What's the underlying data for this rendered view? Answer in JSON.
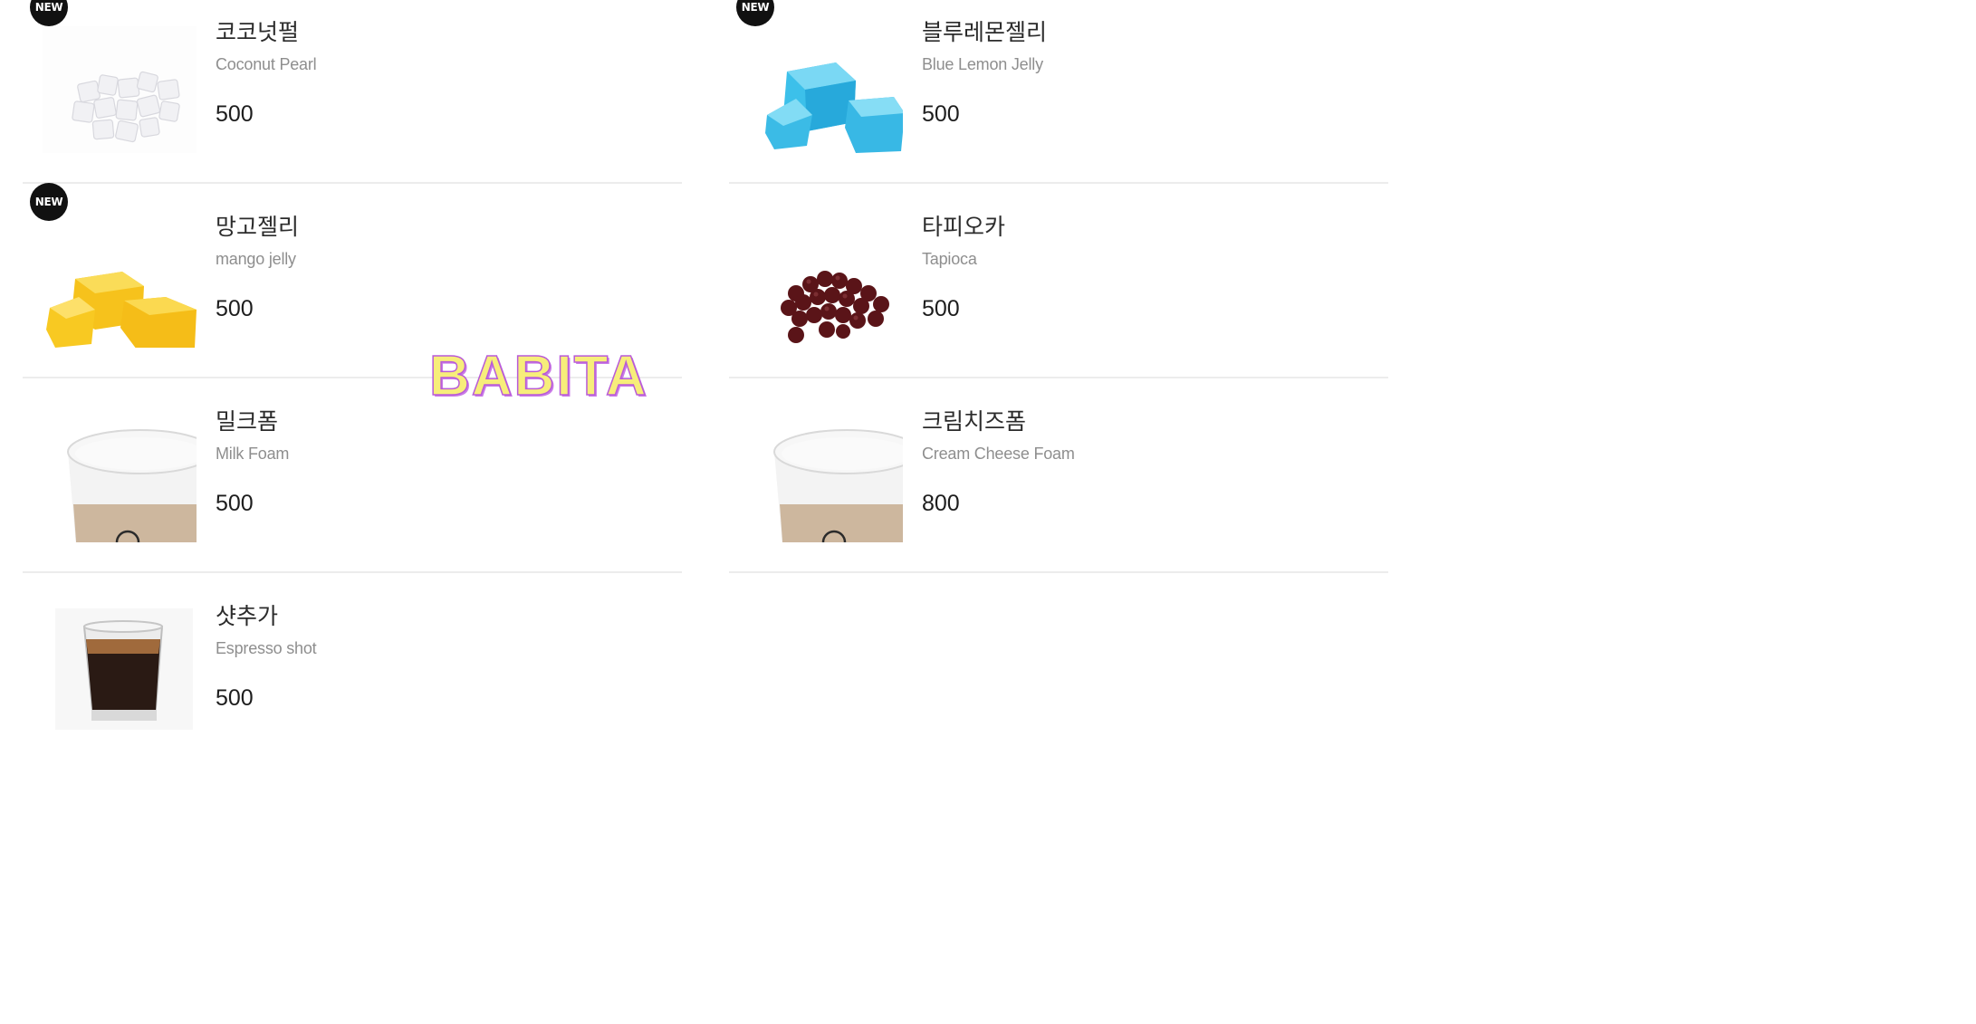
{
  "items": [
    {
      "name_ko": "코코넛펄",
      "name_en": "Coconut Pearl",
      "price": "500",
      "badge": "NEW",
      "icon": "coconut-pearl-icon"
    },
    {
      "name_ko": "블루레몬젤리",
      "name_en": "Blue Lemon Jelly",
      "price": "500",
      "badge": "NEW",
      "icon": "blue-jelly-icon"
    },
    {
      "name_ko": "망고젤리",
      "name_en": "mango jelly",
      "price": "500",
      "badge": "NEW",
      "icon": "mango-jelly-icon"
    },
    {
      "name_ko": "타피오카",
      "name_en": "Tapioca",
      "price": "500",
      "icon": "tapioca-icon"
    },
    {
      "name_ko": "밀크폼",
      "name_en": "Milk Foam",
      "price": "500",
      "icon": "milk-foam-cup-icon"
    },
    {
      "name_ko": "크림치즈폼",
      "name_en": "Cream Cheese Foam",
      "price": "800",
      "icon": "cream-cheese-foam-cup-icon"
    },
    {
      "name_ko": "샷추가",
      "name_en": "Espresso shot",
      "price": "500",
      "icon": "espresso-shot-icon"
    }
  ],
  "watermark": "BABITA",
  "colors": {
    "divider": "#ececec",
    "badge_bg": "#111111",
    "watermark_fill": "#f7ee7a",
    "watermark_stroke": "#b85ad8"
  }
}
